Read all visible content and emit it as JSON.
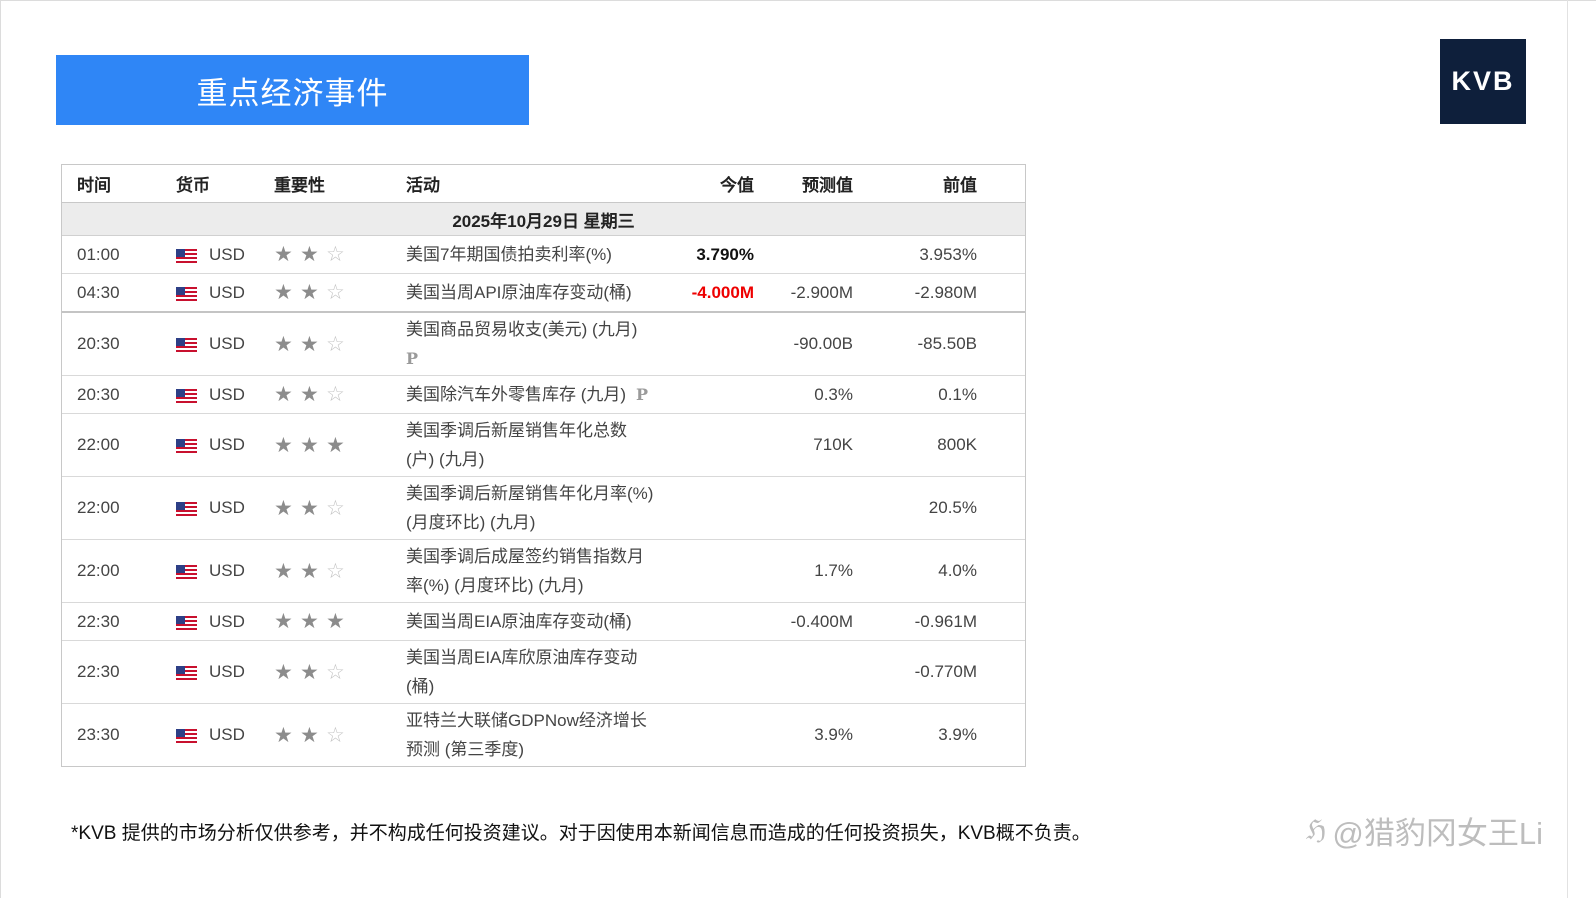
{
  "banner": {
    "title": "重点经济事件"
  },
  "logo": {
    "text": "KVB"
  },
  "calendar": {
    "headers": {
      "time": "时间",
      "currency": "货币",
      "importance": "重要性",
      "event": "活动",
      "actual": "今值",
      "forecast": "预测值",
      "previous": "前值"
    },
    "date": "2025年10月29日  星期三",
    "rows": [
      {
        "time": "01:00",
        "currency": "USD",
        "stars": 2,
        "event": "美国7年期国债拍卖利率(%)",
        "actual": "3.790%",
        "forecast": "",
        "previous": "3.953%"
      },
      {
        "time": "04:30",
        "currency": "USD",
        "stars": 2,
        "event": "美国当周API原油库存变动(桶)",
        "actual": "-4.000M",
        "forecast": "-2.900M",
        "previous": "-2.980M"
      },
      {
        "time": "20:30",
        "currency": "USD",
        "stars": 2,
        "event": "美国商品贸易收支(美元) (九月)",
        "actual": "",
        "forecast": "-90.00B",
        "previous": "-85.50B",
        "p_mark": "P"
      },
      {
        "time": "20:30",
        "currency": "USD",
        "stars": 2,
        "event": "美国除汽车外零售库存 (九月)",
        "actual": "",
        "forecast": "0.3%",
        "previous": "0.1%",
        "p_mark": "P"
      },
      {
        "time": "22:00",
        "currency": "USD",
        "stars": 3,
        "event_line1": "美国季调后新屋销售年化总数",
        "event_line2": "(户) (九月)",
        "actual": "",
        "forecast": "710K",
        "previous": "800K"
      },
      {
        "time": "22:00",
        "currency": "USD",
        "stars": 2,
        "event_line1": "美国季调后新屋销售年化月率(%)",
        "event_line2": "(月度环比) (九月)",
        "actual": "",
        "forecast": "",
        "previous": "20.5%"
      },
      {
        "time": "22:00",
        "currency": "USD",
        "stars": 2,
        "event_line1": "美国季调后成屋签约销售指数月",
        "event_line2": "率(%) (月度环比) (九月)",
        "actual": "",
        "forecast": "1.7%",
        "previous": "4.0%"
      },
      {
        "time": "22:30",
        "currency": "USD",
        "stars": 3,
        "event": "美国当周EIA原油库存变动(桶)",
        "actual": "",
        "forecast": "-0.400M",
        "previous": "-0.961M"
      },
      {
        "time": "22:30",
        "currency": "USD",
        "stars": 2,
        "event_line1": "美国当周EIA库欣原油库存变动",
        "event_line2": "(桶)",
        "actual": "",
        "forecast": "",
        "previous": "-0.770M"
      },
      {
        "time": "23:30",
        "currency": "USD",
        "stars": 2,
        "event_line1": "亚特兰大联储GDPNow经济增长",
        "event_line2": "预测 (第三季度)",
        "actual": "",
        "forecast": "3.9%",
        "previous": "3.9%"
      }
    ],
    "star_glyph_on": "★",
    "star_glyph_off": "☆",
    "flag_icon": "us-flag-icon"
  },
  "colors": {
    "banner_bg": "#2f86f6",
    "logo_bg": "#0e1f3b",
    "actual_negative": "#ee0000"
  },
  "footer": {
    "disclaimer": "*KVB 提供的市场分析仅供参考，并不构成任何投资建议。对于因使用本新闻信息而造成的任何投资损失，KVB概不负责。"
  },
  "watermark": {
    "glyph": "ℌ",
    "text": "@猎豹冈女王Li"
  }
}
